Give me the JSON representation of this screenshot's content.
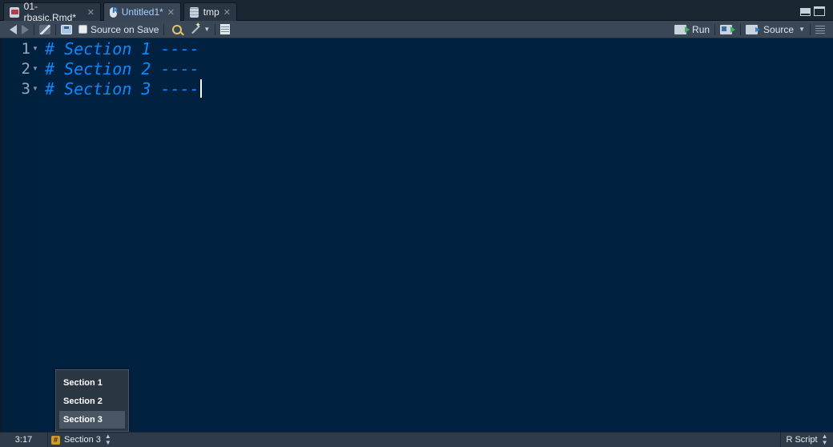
{
  "tabs": [
    {
      "label": "01-rbasic.Rmd*",
      "icon": "rmd-file-icon",
      "active": false
    },
    {
      "label": "Untitled1*",
      "icon": "r-script-icon",
      "active": true
    },
    {
      "label": "tmp",
      "icon": "data-grid-icon",
      "active": false
    }
  ],
  "toolbar": {
    "source_on_save": "Source on Save",
    "run": "Run",
    "source": "Source"
  },
  "editor": {
    "lines": [
      {
        "number": "1",
        "text": "# Section 1 ----"
      },
      {
        "number": "2",
        "text": "# Section 2 ----"
      },
      {
        "number": "3",
        "text": "# Section 3 ----"
      }
    ]
  },
  "popup": {
    "items": [
      "Section 1",
      "Section 2",
      "Section 3"
    ],
    "selected": "Section 3"
  },
  "status": {
    "position": "3:17",
    "section_icon": "#",
    "section": "Section 3",
    "file_type": "R Script"
  },
  "colors": {
    "editor_bg": "#002240",
    "comment": "#0a88ff"
  }
}
